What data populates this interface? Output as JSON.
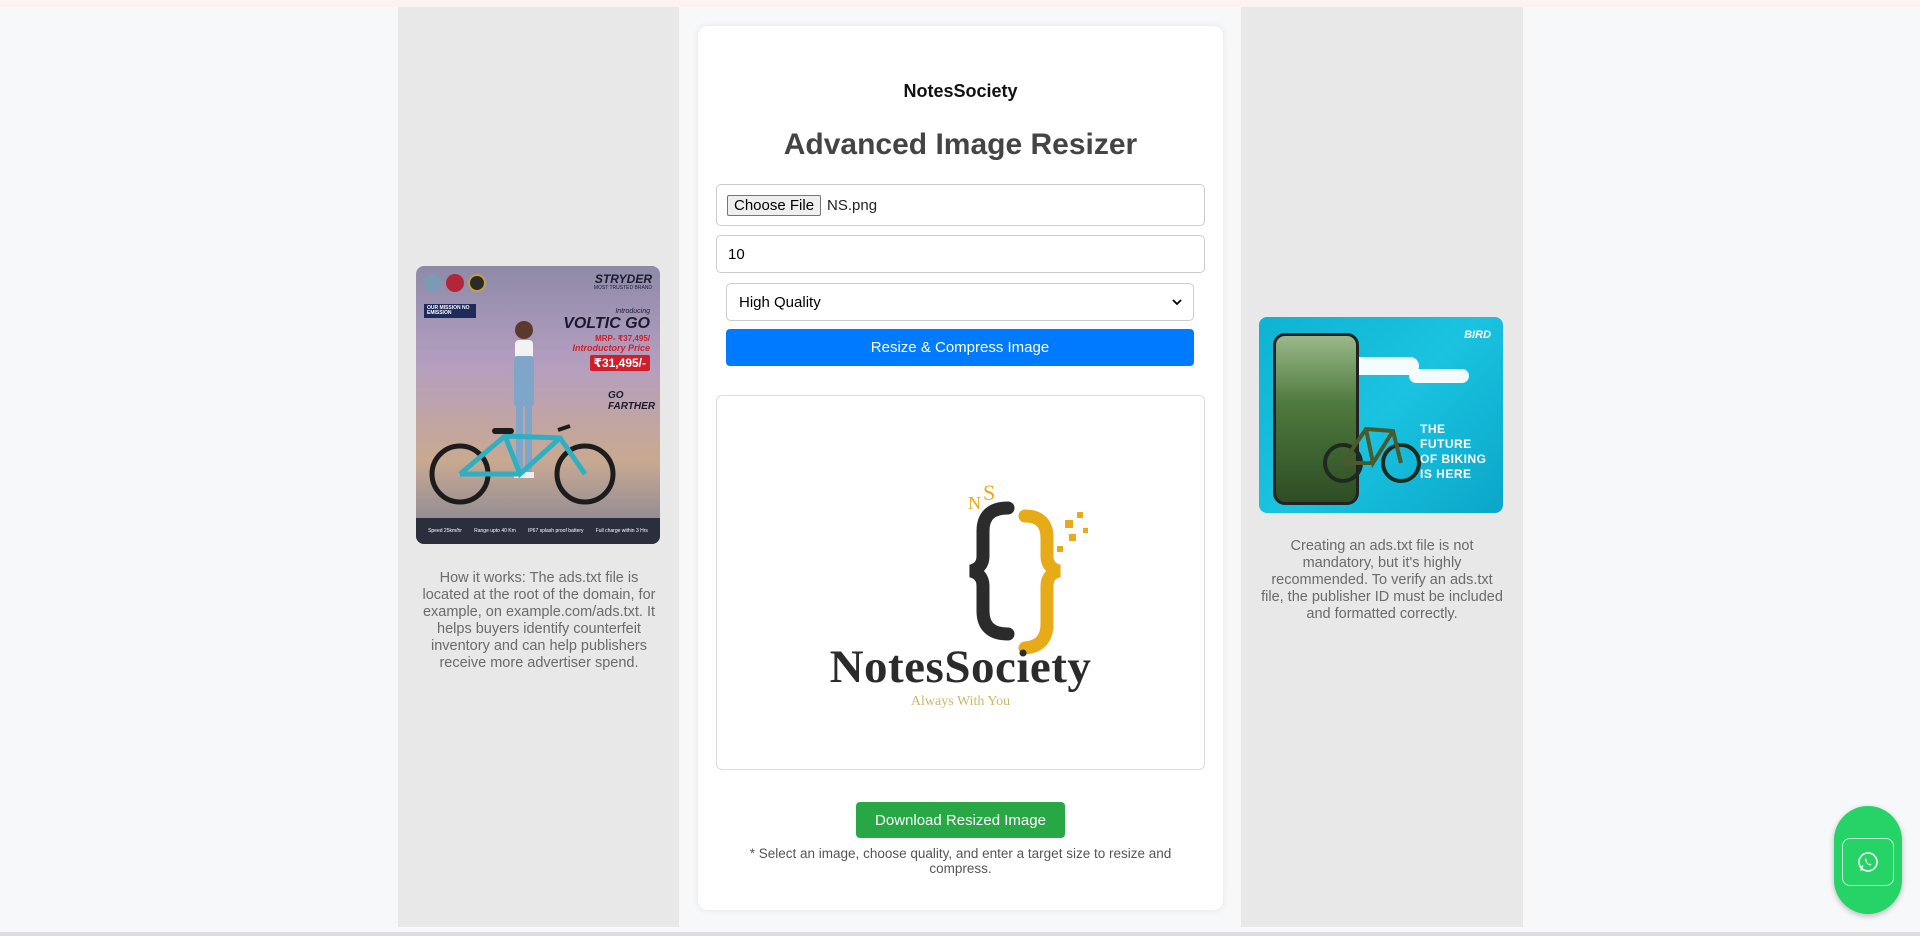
{
  "header": {
    "brand": "NotesSociety",
    "title": "Advanced Image Resizer"
  },
  "form": {
    "file_button_label": "Choose File",
    "file_name": "NS.png",
    "target_size_value": "10",
    "quality_selected": "High Quality",
    "resize_button_label": "Resize & Compress Image"
  },
  "preview": {
    "logo_initials": "NS",
    "logo_name": "NotesSociety",
    "logo_tagline": "Always With You"
  },
  "actions": {
    "download_button_label": "Download Resized Image",
    "help_note": "* Select an image, choose quality, and enter a target size to resize and compress."
  },
  "left_sidebar": {
    "ad": {
      "brand": "STRYDER",
      "brand_sub": "MOST TRUSTED BRAND",
      "mission": "OUR MISSION NO EMISSION",
      "intro_label": "Introducing",
      "product": "VOLTIC GO",
      "mrp": "MRP- ₹37,495/",
      "intro_price_label": "Introductory Price",
      "price": "₹31,495/-",
      "slogan": "GO FARTHER",
      "features": [
        "Speed 25km/hr",
        "Range upto 40 Km",
        "IP67 splash proof battery",
        "Full charge within 3 Hrs"
      ]
    },
    "text": "How it works: The ads.txt file is located at the root of the domain, for example, on example.com/ads.txt. It helps buyers identify counterfeit inventory and can help publishers receive more advertiser spend."
  },
  "right_sidebar": {
    "ad": {
      "brand": "BIRD",
      "tagline": [
        "THE",
        "FUTURE",
        "OF BIKING",
        "IS HERE"
      ]
    },
    "text": "Creating an ads.txt file is not mandatory, but it's highly recommended. To verify an ads.txt file, the publisher ID must be included and formatted correctly."
  },
  "floating": {
    "icon": "whatsapp-icon"
  },
  "colors": {
    "primary_button": "#007bff",
    "download_button": "#28a745",
    "whatsapp": "#25d366",
    "logo_gold": "#e6ab17"
  }
}
